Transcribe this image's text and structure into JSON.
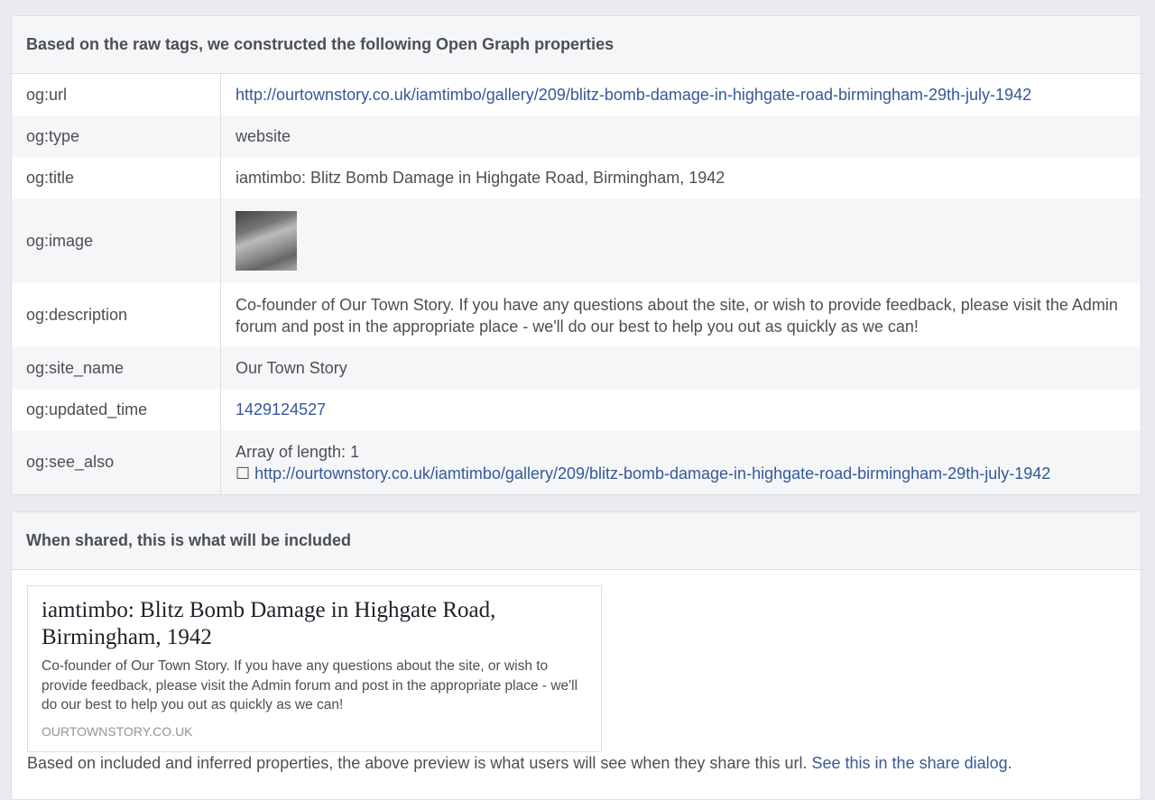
{
  "og_panel": {
    "title": "Based on the raw tags, we constructed the following Open Graph properties",
    "rows": [
      {
        "key": "og:url",
        "value": "http://ourtownstory.co.uk/iamtimbo/gallery/209/blitz-bomb-damage-in-highgate-road-birmingham-29th-july-1942"
      },
      {
        "key": "og:type",
        "value": "website"
      },
      {
        "key": "og:title",
        "value": "iamtimbo: Blitz Bomb Damage in Highgate Road, Birmingham, 1942"
      },
      {
        "key": "og:image",
        "value": ""
      },
      {
        "key": "og:description",
        "value": "Co-founder of Our Town Story. If you have any questions about the site, or wish to provide feedback, please visit the Admin forum and post in the appropriate place - we'll do our best to help you out as quickly as we can!"
      },
      {
        "key": "og:site_name",
        "value": "Our Town Story"
      },
      {
        "key": "og:updated_time",
        "value": "1429124527"
      },
      {
        "key": "og:see_also",
        "array_label": "Array of length: 1",
        "bullet": "☐",
        "value": "http://ourtownstory.co.uk/iamtimbo/gallery/209/blitz-bomb-damage-in-highgate-road-birmingham-29th-july-1942"
      }
    ]
  },
  "share_panel": {
    "title": "When shared, this is what will be included",
    "card": {
      "title": "iamtimbo: Blitz Bomb Damage in Highgate Road, Birmingham, 1942",
      "description": "Co-founder of Our Town Story. If you have any questions about the site, or wish to provide feedback, please visit the Admin forum and post in the appropriate place - we'll do our best to help you out as quickly as we can!",
      "domain": "OURTOWNSTORY.CO.UK"
    },
    "footer_text": "Based on included and inferred properties, the above preview is what users will see when they share this url.",
    "footer_link": "See this in the share dialog."
  }
}
